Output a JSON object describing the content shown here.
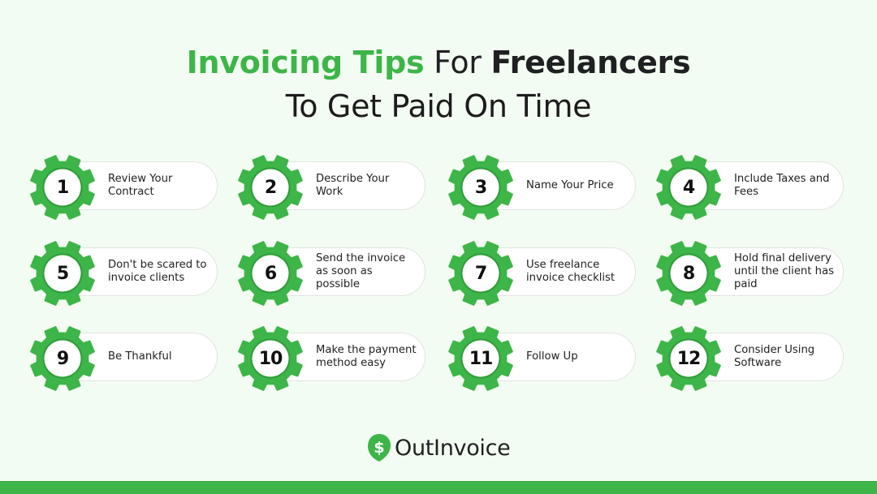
{
  "title": {
    "part1": "Invoicing Tips",
    "part2": "For",
    "part3": "Freelancers",
    "line2": "To Get Paid On Time"
  },
  "colors": {
    "accent": "#3db548",
    "accent_dark": "#2f9c3a",
    "background": "#f3fcf2",
    "text": "#1f2021"
  },
  "tips": [
    {
      "number": "1",
      "text": "Review Your Contract"
    },
    {
      "number": "2",
      "text": "Describe Your Work"
    },
    {
      "number": "3",
      "text": "Name Your Price"
    },
    {
      "number": "4",
      "text": "Include Taxes and Fees"
    },
    {
      "number": "5",
      "text": "Don't be scared to invoice clients"
    },
    {
      "number": "6",
      "text": "Send the invoice as soon as possible"
    },
    {
      "number": "7",
      "text": "Use freelance invoice checklist"
    },
    {
      "number": "8",
      "text": "Hold final delivery until the client has paid"
    },
    {
      "number": "9",
      "text": "Be Thankful"
    },
    {
      "number": "10",
      "text": "Make the payment method easy"
    },
    {
      "number": "11",
      "text": "Follow Up"
    },
    {
      "number": "12",
      "text": "Consider Using Software"
    }
  ],
  "logo": {
    "icon": "dollar-pin-icon",
    "symbol": "$",
    "text": "OutInvoice"
  }
}
